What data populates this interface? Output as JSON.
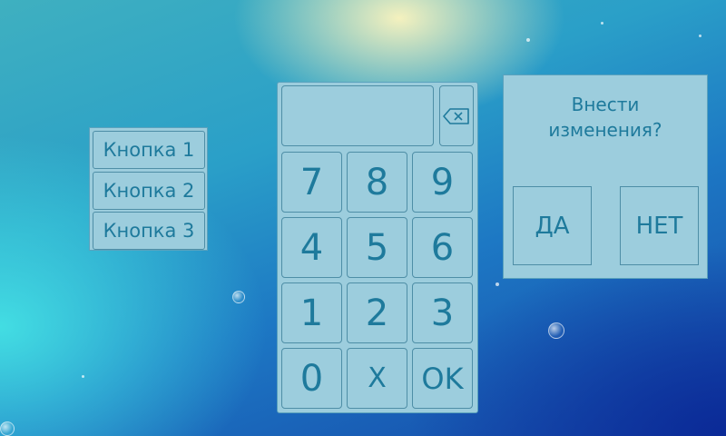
{
  "menu": {
    "items": [
      {
        "label": "Кнопка 1"
      },
      {
        "label": "Кнопка 2"
      },
      {
        "label": "Кнопка 3"
      }
    ]
  },
  "keypad": {
    "display_value": "",
    "backspace_icon": "backspace-icon",
    "keys": [
      "7",
      "8",
      "9",
      "4",
      "5",
      "6",
      "1",
      "2",
      "3",
      "0",
      "X",
      "OK"
    ]
  },
  "dialog": {
    "line1": "Внести",
    "line2": "изменения?",
    "yes_label": "ДА",
    "no_label": "НЕТ"
  },
  "colors": {
    "panel": "#9ccddd",
    "border": "#4e8ea6",
    "text": "#1e7a9c"
  }
}
